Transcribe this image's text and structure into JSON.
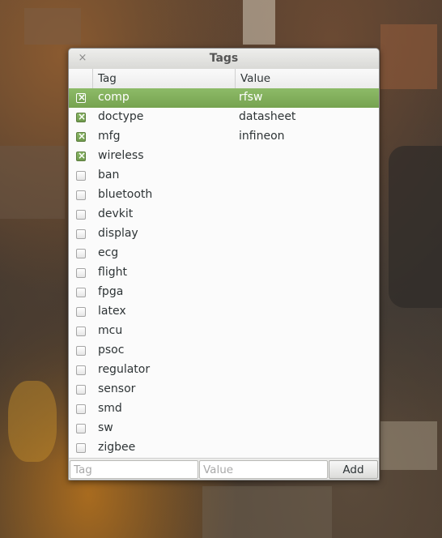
{
  "window": {
    "title": "Tags",
    "close_glyph": "×"
  },
  "columns": {
    "tag": "Tag",
    "value": "Value"
  },
  "rows": [
    {
      "tag": "comp",
      "value": "rfsw",
      "checked": true,
      "selected": true
    },
    {
      "tag": "doctype",
      "value": "datasheet",
      "checked": true,
      "selected": false
    },
    {
      "tag": "mfg",
      "value": "infineon",
      "checked": true,
      "selected": false
    },
    {
      "tag": "wireless",
      "value": "",
      "checked": true,
      "selected": false
    },
    {
      "tag": "ban",
      "value": "",
      "checked": false,
      "selected": false
    },
    {
      "tag": "bluetooth",
      "value": "",
      "checked": false,
      "selected": false
    },
    {
      "tag": "devkit",
      "value": "",
      "checked": false,
      "selected": false
    },
    {
      "tag": "display",
      "value": "",
      "checked": false,
      "selected": false
    },
    {
      "tag": "ecg",
      "value": "",
      "checked": false,
      "selected": false
    },
    {
      "tag": "flight",
      "value": "",
      "checked": false,
      "selected": false
    },
    {
      "tag": "fpga",
      "value": "",
      "checked": false,
      "selected": false
    },
    {
      "tag": "latex",
      "value": "",
      "checked": false,
      "selected": false
    },
    {
      "tag": "mcu",
      "value": "",
      "checked": false,
      "selected": false
    },
    {
      "tag": "psoc",
      "value": "",
      "checked": false,
      "selected": false
    },
    {
      "tag": "regulator",
      "value": "",
      "checked": false,
      "selected": false
    },
    {
      "tag": "sensor",
      "value": "",
      "checked": false,
      "selected": false
    },
    {
      "tag": "smd",
      "value": "",
      "checked": false,
      "selected": false
    },
    {
      "tag": "sw",
      "value": "",
      "checked": false,
      "selected": false
    },
    {
      "tag": "zigbee",
      "value": "",
      "checked": false,
      "selected": false
    }
  ],
  "inputs": {
    "tag": {
      "value": "",
      "placeholder": "Tag"
    },
    "value": {
      "value": "",
      "placeholder": "Value"
    }
  },
  "add_label": "Add",
  "colors": {
    "selection": "#7fac58",
    "checkbox_on": "#7ba656"
  }
}
